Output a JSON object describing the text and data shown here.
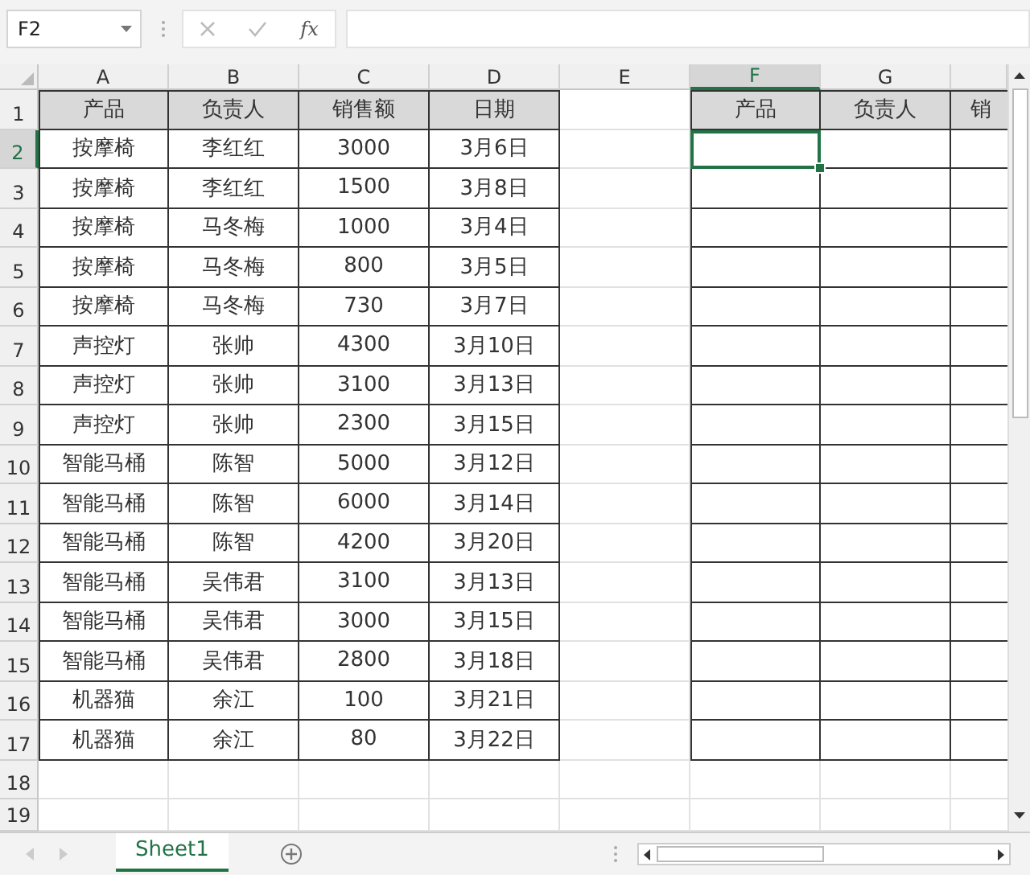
{
  "formula_bar": {
    "name_box": "F2",
    "function_symbol": "fx"
  },
  "columns": [
    {
      "label": "A",
      "selected": false
    },
    {
      "label": "B",
      "selected": false
    },
    {
      "label": "C",
      "selected": false
    },
    {
      "label": "D",
      "selected": false
    },
    {
      "label": "E",
      "selected": false
    },
    {
      "label": "F",
      "selected": true
    },
    {
      "label": "G",
      "selected": false
    }
  ],
  "rows": [
    {
      "label": "1",
      "selected": false
    },
    {
      "label": "2",
      "selected": true
    },
    {
      "label": "3",
      "selected": false
    },
    {
      "label": "4",
      "selected": false
    },
    {
      "label": "5",
      "selected": false
    },
    {
      "label": "6",
      "selected": false
    },
    {
      "label": "7",
      "selected": false
    },
    {
      "label": "8",
      "selected": false
    },
    {
      "label": "9",
      "selected": false
    },
    {
      "label": "10",
      "selected": false
    },
    {
      "label": "11",
      "selected": false
    },
    {
      "label": "12",
      "selected": false
    },
    {
      "label": "13",
      "selected": false
    },
    {
      "label": "14",
      "selected": false
    },
    {
      "label": "15",
      "selected": false
    },
    {
      "label": "16",
      "selected": false
    },
    {
      "label": "17",
      "selected": false
    },
    {
      "label": "18",
      "selected": false
    },
    {
      "label": "19",
      "selected": false
    }
  ],
  "source_table": {
    "header": [
      "产品",
      "负责人",
      "销售额",
      "日期"
    ],
    "rows": [
      [
        "按摩椅",
        "李红红",
        "3000",
        "3月6日"
      ],
      [
        "按摩椅",
        "李红红",
        "1500",
        "3月8日"
      ],
      [
        "按摩椅",
        "马冬梅",
        "1000",
        "3月4日"
      ],
      [
        "按摩椅",
        "马冬梅",
        "800",
        "3月5日"
      ],
      [
        "按摩椅",
        "马冬梅",
        "730",
        "3月7日"
      ],
      [
        "声控灯",
        "张帅",
        "4300",
        "3月10日"
      ],
      [
        "声控灯",
        "张帅",
        "3100",
        "3月13日"
      ],
      [
        "声控灯",
        "张帅",
        "2300",
        "3月15日"
      ],
      [
        "智能马桶",
        "陈智",
        "5000",
        "3月12日"
      ],
      [
        "智能马桶",
        "陈智",
        "6000",
        "3月14日"
      ],
      [
        "智能马桶",
        "陈智",
        "4200",
        "3月20日"
      ],
      [
        "智能马桶",
        "吴伟君",
        "3100",
        "3月13日"
      ],
      [
        "智能马桶",
        "吴伟君",
        "3000",
        "3月15日"
      ],
      [
        "智能马桶",
        "吴伟君",
        "2800",
        "3月18日"
      ],
      [
        "机器猫",
        "余江",
        "100",
        "3月21日"
      ],
      [
        "机器猫",
        "余江",
        "80",
        "3月22日"
      ]
    ]
  },
  "target_table": {
    "header": [
      "产品",
      "负责人",
      "销"
    ]
  },
  "sheet_tabs": [
    {
      "label": "Sheet1",
      "selected": true
    }
  ]
}
